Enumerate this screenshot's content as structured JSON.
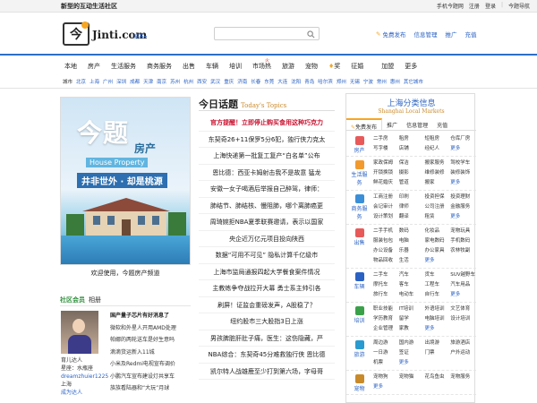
{
  "topbar": {
    "slogan": "新型的互动生活社区",
    "links": [
      "手机今题网",
      "注册",
      "登录",
      "今题导航"
    ]
  },
  "header": {
    "logo_char": "今",
    "logo_text": "Jinti.com",
    "city": "城市",
    "search_placeholder": "",
    "links": [
      "免费发布",
      "信息管理",
      "推广",
      "充值"
    ]
  },
  "nav": {
    "items": [
      "本地",
      "房产",
      "生活服务",
      "商务服务",
      "出售",
      "车辆",
      "培训",
      "市场",
      "旅游",
      "宠物",
      "奖",
      "征婚",
      "加盟",
      "更多"
    ],
    "market_sup": "火",
    "market_suffix": "热"
  },
  "cities": [
    "城市",
    "北京",
    "上海",
    "广州",
    "深圳",
    "成都",
    "天津",
    "南京",
    "苏州",
    "杭州",
    "西安",
    "武汉",
    "重庆",
    "济南",
    "长春",
    "东莞",
    "大连",
    "沈阳",
    "青岛",
    "哈尔滨",
    "郑州",
    "无锡",
    "宁波",
    "常州",
    "惠州",
    "其它城市"
  ],
  "banner": {
    "title": "今题",
    "subtitle": "房产",
    "english": "House Property",
    "slogan": "井非世外 · 却是桃源",
    "caption": "欢迎使用，今题房产频道"
  },
  "members": {
    "title": "社区会员",
    "subtitle": "相册",
    "profile_lines": [
      "育儿达人",
      "星座：水瓶座",
      "dreamzhuier1225",
      "上海",
      "成为达人"
    ],
    "news": [
      "国产量子芯片有好消息了",
      "微软和外星人开用AMD处理",
      "帕娜的两轮送车是好生意吗",
      "滴滴货运新入11城",
      "小米及Redmi电视宣布调价",
      "小鹏汽车宣布建设灯共享车",
      "族族看陆器和“大玩”月球"
    ]
  },
  "topics": {
    "title": "今日话题",
    "title_en": "Today's Topics",
    "items": [
      "官方提醒！立即停止购买食用这种巧克力",
      "东契奇26+11保罗5分6犯，独行侠力克太",
      "上海快递第一批复工复产“白名单”公布",
      "恩比德：西亚卡姆射击我不是故意 猛龙",
      "安徽一女子喝酒后举报自己醉驾，律师：",
      "肺结节、肺结核、慢阻肺，哪个离肺癌更",
      "周琦婉拒NBA夏季联赛邀请，表示以国家",
      "央企近万亿元项目投向陕西",
      "数据“可用不可见” 隐私计算千亿级市",
      "上海市监局通报四起大学餐食案件情况",
      "主教练争夺战拉开大幕 勇士系主帅引各",
      "刷屏！证监会重磅发声，A股稳了？",
      "纽约股市三大股指3日上涨",
      "男孩脾脏肝肚子痛，医生：这伤隐藏，严",
      "NBA综合：东契奇45分难救独行侠 恩比德",
      "凯尔特人战雄鹿至少打到第六场，字母哥"
    ]
  },
  "classifieds": {
    "title": "上海分类信息",
    "title_en": "Shanghai Local Markets",
    "tabs": [
      "免费发布",
      "推广",
      "信息管理",
      "充值"
    ],
    "categories": [
      {
        "name": "房产",
        "color": "#e85a5a",
        "items": [
          "二手房",
          "租房",
          "短租房",
          "仓库厂房",
          "写字楼",
          "店铺",
          "经纪人",
          "更多"
        ]
      },
      {
        "name": "生活服务",
        "color": "#f29a2e",
        "items": [
          "家政保姆",
          "保洁",
          "搬家服务",
          "驾校学车",
          "开锁换锁",
          "摄影",
          "维修装修",
          "装修装饰",
          "鲜花婚庆",
          "管道",
          "搬家",
          "更多"
        ]
      },
      {
        "name": "商务服务",
        "color": "#3b8fd8",
        "items": [
          "工商注册",
          "印刷",
          "投资担保",
          "投资理财",
          "会记审计",
          "律师",
          "公司注册",
          "金融服务",
          "设计策划",
          "翻译",
          "租赁",
          "更多"
        ]
      },
      {
        "name": "出售",
        "color": "#e85a5a",
        "items": [
          "二手手机",
          "数码",
          "化妆品",
          "宠物玩具",
          "服装包包",
          "电脑",
          "家电数码",
          "手机数码",
          "办公设备",
          "乐器",
          "办公家具",
          "农林牧副",
          "物品回收",
          "生活",
          "更多"
        ]
      },
      {
        "name": "车辆",
        "color": "#2a62c4",
        "items": [
          "二手车",
          "汽车",
          "货车",
          "SUV越野车",
          "摩托车",
          "客车",
          "工程车",
          "汽车用品",
          "旅行车",
          "电动车",
          "自行车",
          "更多"
        ]
      },
      {
        "name": "培训",
        "color": "#3aa14a",
        "items": [
          "职业技能",
          "IT培训",
          "外语培训",
          "文艺体育",
          "学历教育",
          "留学",
          "电脑培训",
          "设计培训",
          "企业管理",
          "家教",
          "更多"
        ]
      },
      {
        "name": "旅游",
        "color": "#2a9bd0",
        "items": [
          "周边游",
          "国内游",
          "出境游",
          "旅游酒店",
          "一日游",
          "签证",
          "门票",
          "户外运动",
          "机票",
          "更多"
        ]
      },
      {
        "name": "宠物",
        "color": "#c98a2a",
        "items": [
          "宠物狗",
          "宠物猫",
          "花鸟鱼虫",
          "宠物服务",
          "更多"
        ]
      }
    ]
  },
  "colors": {
    "accent": "#2d6fc7",
    "hot": "#c8102e",
    "orange": "#f6a623",
    "green": "#2d8d3a"
  }
}
